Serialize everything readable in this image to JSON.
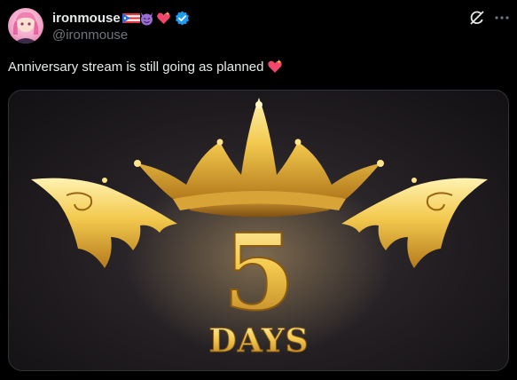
{
  "author": {
    "display_name": "ironmouse",
    "handle": "@ironmouse",
    "name_emojis": [
      "puerto-rico-flag",
      "smiling-imp",
      "sparkling-heart"
    ],
    "verified": true,
    "verified_color": "#1d9bf0"
  },
  "tweet": {
    "text": "Anniversary stream is still going as planned",
    "text_emoji": "sparkling-heart"
  },
  "media": {
    "number": "5",
    "caption": "DAYS",
    "gold": "#e8b53c",
    "background": "#231f23"
  },
  "colors": {
    "background": "#000000",
    "text_primary": "#e7e9ea",
    "text_secondary": "#71767b"
  },
  "icons": {
    "grok": "grok-icon",
    "more": "more-options-icon"
  }
}
